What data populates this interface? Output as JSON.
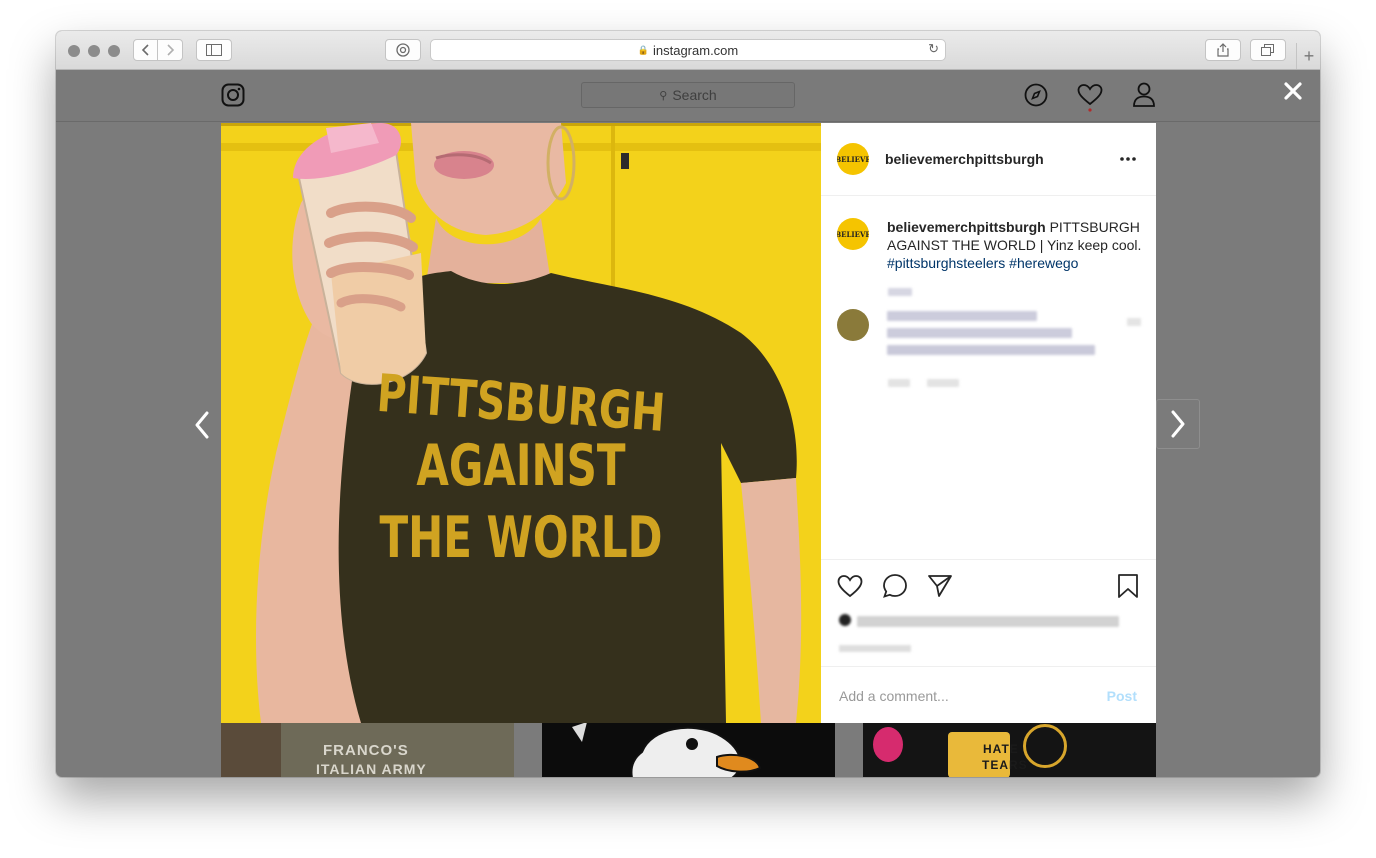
{
  "browser": {
    "url": "instagram.com"
  },
  "ig": {
    "search_placeholder": "Search",
    "icons": [
      "instagram-logo-icon",
      "compass-icon",
      "heart-icon",
      "profile-icon"
    ]
  },
  "post": {
    "username": "believemerchpittsburgh",
    "avatar_logo": "BELIEVE",
    "caption": "PITTSBURGH AGAINST THE WORLD | Yinz keep cool.",
    "hashtags": "#pittsburghsteelers #herewego",
    "shirt_lines": [
      "PITTSBURGH",
      "AGAINST",
      "THE WORLD"
    ],
    "comment_placeholder": "Add a comment...",
    "post_label": "Post"
  },
  "grid": {
    "thumb1_text_1": "FRANCO'S",
    "thumb1_text_2": "ITALIAN ARMY",
    "thumb3_text_1": "HATE",
    "thumb3_text_2": "TEARS"
  },
  "colors": {
    "overlay": "#7b7b7b",
    "photo_yellow": "#f3d21b",
    "shirt": "#35301c",
    "shirt_text": "#d0a321",
    "link": "#003569",
    "post_disabled": "#b2dffc"
  }
}
